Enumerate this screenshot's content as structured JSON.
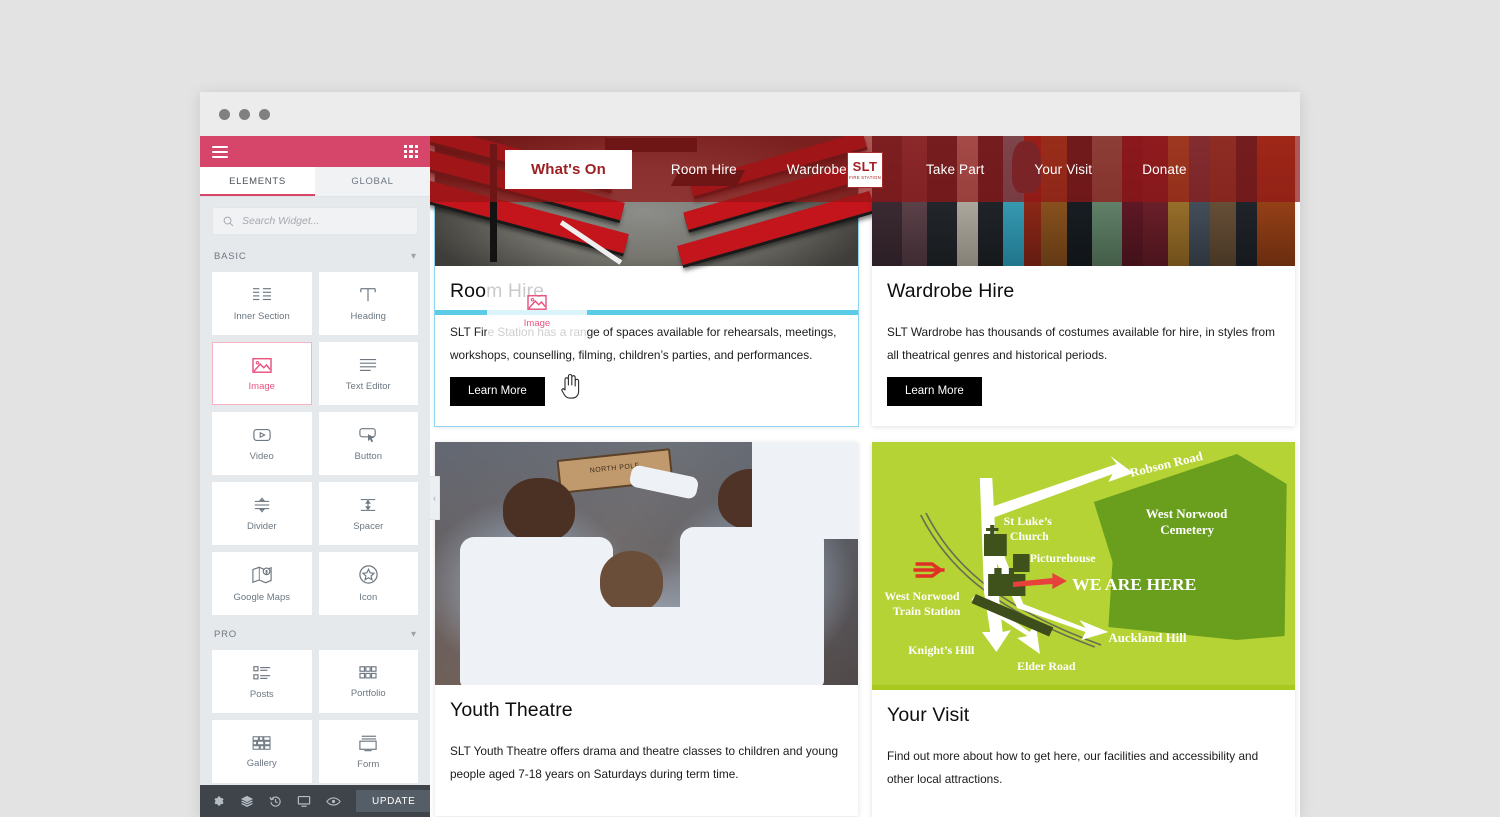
{
  "window": {
    "dots": [
      "red",
      "yellow",
      "green"
    ]
  },
  "panel": {
    "menu_icon": "hamburger-menu-icon",
    "apps_icon": "grid-apps-icon",
    "tabs": [
      {
        "label": "ELEMENTS",
        "active": true
      },
      {
        "label": "GLOBAL",
        "active": false
      }
    ],
    "search": {
      "placeholder": "Search Widget...",
      "value": "",
      "icon": "search-icon"
    },
    "categories": [
      {
        "label": "BASIC",
        "expanded": true,
        "widgets": [
          {
            "label": "Inner Section",
            "icon": "inner-section-icon",
            "selected": false
          },
          {
            "label": "Heading",
            "icon": "heading-icon",
            "selected": false
          },
          {
            "label": "Image",
            "icon": "image-icon",
            "selected": true
          },
          {
            "label": "Text Editor",
            "icon": "text-editor-icon",
            "selected": false
          },
          {
            "label": "Video",
            "icon": "video-icon",
            "selected": false
          },
          {
            "label": "Button",
            "icon": "button-icon",
            "selected": false
          },
          {
            "label": "Divider",
            "icon": "divider-icon",
            "selected": false
          },
          {
            "label": "Spacer",
            "icon": "spacer-icon",
            "selected": false
          },
          {
            "label": "Google Maps",
            "icon": "google-maps-icon",
            "selected": false
          },
          {
            "label": "Icon",
            "icon": "star-icon",
            "selected": false
          }
        ]
      },
      {
        "label": "PRO",
        "expanded": true,
        "widgets": [
          {
            "label": "Posts",
            "icon": "posts-icon",
            "selected": false
          },
          {
            "label": "Portfolio",
            "icon": "portfolio-icon",
            "selected": false
          },
          {
            "label": "Gallery",
            "icon": "gallery-icon",
            "selected": false
          },
          {
            "label": "Form",
            "icon": "form-icon",
            "selected": false
          }
        ]
      }
    ],
    "footer": {
      "icons": [
        "settings-gear-icon",
        "navigator-layers-icon",
        "history-revisions-icon",
        "responsive-mode-icon",
        "preview-eye-icon"
      ],
      "update_label": "UPDATE",
      "caret": "caret-up-icon"
    },
    "accent_color": "#d6456a",
    "footer_bg": "#3f444b"
  },
  "canvas": {
    "collapse_handle": "collapse-panel-icon",
    "navbar": {
      "logo": {
        "line1": "SLT",
        "line2": "FIRE STATION"
      },
      "left_items": [
        {
          "label": "What's On",
          "active": true
        },
        {
          "label": "Room Hire",
          "active": false
        },
        {
          "label": "Wardrobe Hire",
          "active": false
        }
      ],
      "right_items": [
        {
          "label": "Take Part",
          "active": false
        },
        {
          "label": "Your Visit",
          "active": false
        },
        {
          "label": "Donate",
          "active": false
        }
      ],
      "bg_color": "#911616"
    },
    "cards": [
      {
        "id": "room-hire",
        "title": "Room Hire",
        "text": "SLT Fire Station has a range of spaces available for rehearsals, meetings, workshops, counselling, filming, children’s parties, and performances.",
        "button": "Learn More",
        "image": "theatre-seating-photo",
        "selected": true
      },
      {
        "id": "wardrobe-hire",
        "title": "Wardrobe Hire",
        "text": "SLT Wardrobe has thousands of costumes available for hire, in styles from all theatrical genres and historical periods.",
        "button": "Learn More",
        "image": "costume-rail-photo",
        "selected": false
      },
      {
        "id": "youth-theatre",
        "title": "Youth Theatre",
        "text": "SLT Youth Theatre offers drama and theatre classes to children and young people aged 7-18 years on Saturdays during term time.",
        "button": "",
        "image": "youth-theatre-performance-photo",
        "selected": false
      },
      {
        "id": "your-visit",
        "title": "Your Visit",
        "text": "Find out more about how to get here, our facilities and accessibility and other local attractions.",
        "button": "",
        "image": "location-map",
        "selected": false
      }
    ],
    "map": {
      "bg_color": "#b5d334",
      "cemetery_color": "#6a9f1e",
      "labels": [
        "Robson Road",
        "West Norwood Cemetery",
        "St Luke's Church",
        "Picturehouse",
        "WE ARE HERE",
        "West Norwood Train Station",
        "Knight's Hill",
        "Elder Road",
        "Auckland Hill"
      ]
    },
    "drag_ghost": {
      "label": "Image",
      "icon": "image-icon"
    },
    "drop_indicator_color": "#5bcbe8",
    "selection_outline_color": "#8fd5ef"
  }
}
